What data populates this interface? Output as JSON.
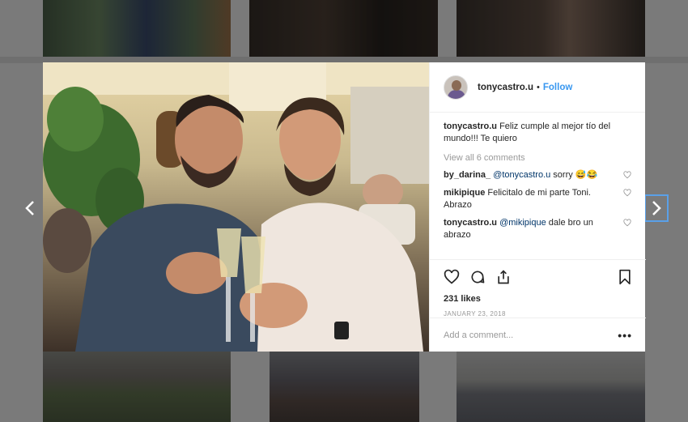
{
  "post": {
    "username": "tonycastro.u",
    "separator": "•",
    "follow_label": "Follow",
    "caption_user": "tonycastro.u",
    "caption_text": "Feliz cumple al mejor tío del mundo!!! Te quiero",
    "view_all": "View all 6 comments",
    "comments": [
      {
        "user": "by_darina_",
        "mention": "@tonycastro.u",
        "text": " sorry 😅😂"
      },
      {
        "user": "mikipique",
        "mention": "",
        "text": "Felicitalo de mi parte Toni. Abrazo"
      },
      {
        "user": "tonycastro.u",
        "mention": "@mikipique",
        "text": " dale bro un abrazo"
      }
    ],
    "likes": "231 likes",
    "date": "JANUARY 23, 2018",
    "add_comment_placeholder": "Add a comment...",
    "more_label": "•••"
  },
  "icons": {
    "prev": "chevron-left-icon",
    "next": "chevron-right-icon",
    "like": "heart-icon",
    "comment": "comment-icon",
    "share": "share-icon",
    "save": "bookmark-icon"
  },
  "colors": {
    "accent": "#3897f0",
    "text": "#262626",
    "muted": "#999999",
    "mention": "#003569"
  }
}
